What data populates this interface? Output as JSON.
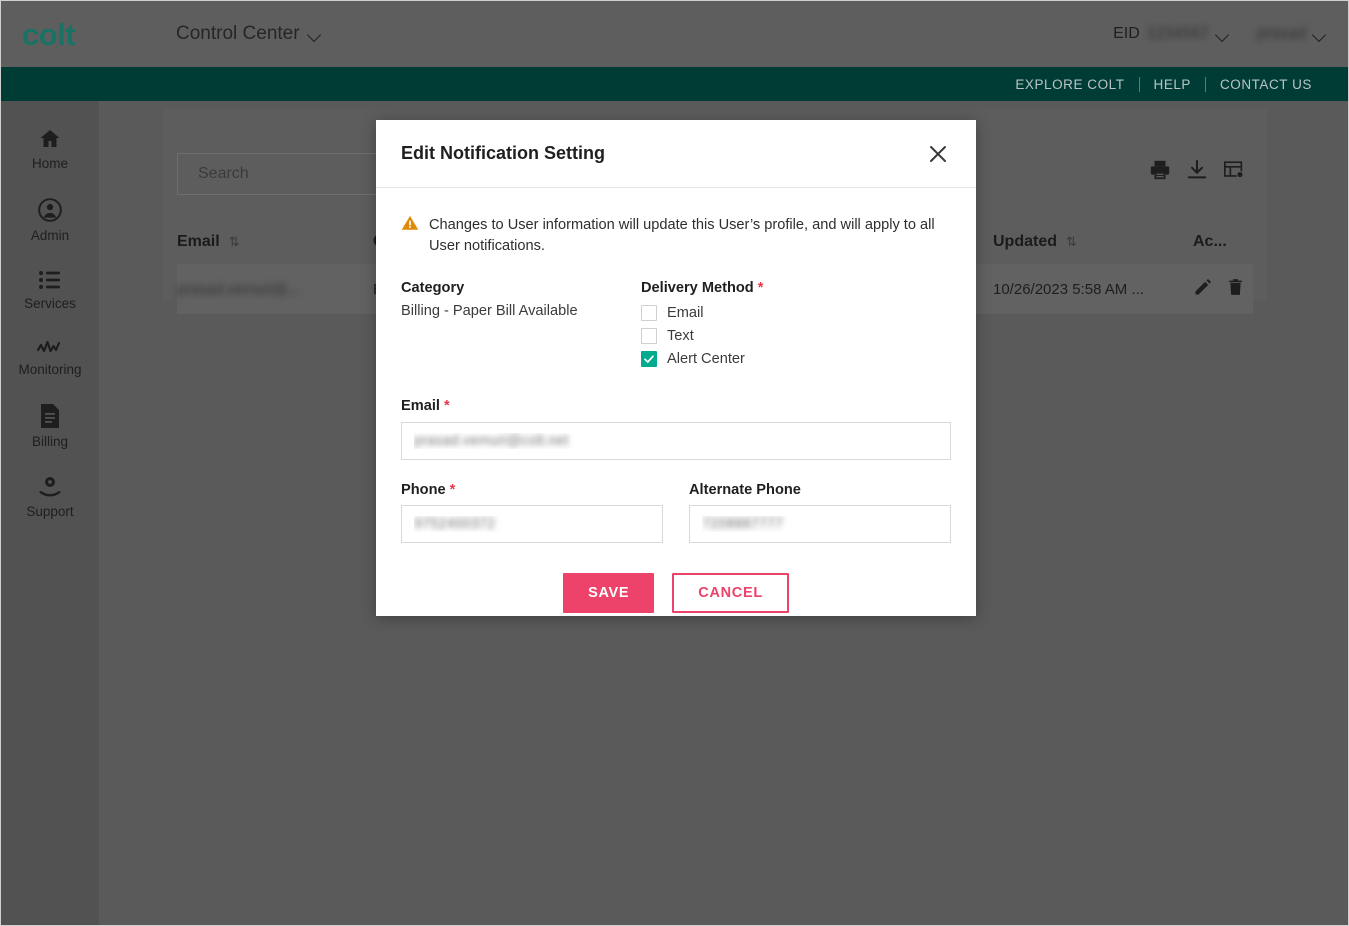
{
  "header": {
    "logo_text": "colt",
    "app_switcher_label": "Control Center",
    "eid_label": "EID",
    "eid_value": "1234567",
    "account_value": "prasad"
  },
  "utility_nav": {
    "items": [
      {
        "label": "EXPLORE COLT"
      },
      {
        "label": "HELP"
      },
      {
        "label": "CONTACT US"
      }
    ]
  },
  "sidebar": {
    "items": [
      {
        "label": "Home",
        "icon": "home-icon"
      },
      {
        "label": "Admin",
        "icon": "user-circle-icon"
      },
      {
        "label": "Services",
        "icon": "list-icon"
      },
      {
        "label": "Monitoring",
        "icon": "activity-icon"
      },
      {
        "label": "Billing",
        "icon": "invoice-icon"
      },
      {
        "label": "Support",
        "icon": "support-gear-hand-icon"
      }
    ]
  },
  "main": {
    "search": {
      "placeholder": "Search",
      "value": ""
    },
    "toolbar_icons": [
      {
        "name": "print-icon"
      },
      {
        "name": "download-icon"
      },
      {
        "name": "table-settings-icon"
      }
    ],
    "table": {
      "columns": [
        {
          "label": "Email",
          "sortable": true
        },
        {
          "label": "Cate...",
          "sortable": false
        },
        {
          "label": "Updated",
          "sortable": true
        },
        {
          "label": "Ac...",
          "sortable": false
        }
      ],
      "sort_glyph": "⇅",
      "rows": [
        {
          "email": "prasad.vemuri@...",
          "category": "Billi...",
          "updated": "10/26/2023 5:58 AM ...",
          "actions": [
            "edit-icon",
            "delete-icon"
          ]
        }
      ]
    }
  },
  "modal": {
    "title": "Edit Notification Setting",
    "close_label": "×",
    "alert": {
      "icon": "warning-triangle-icon",
      "text": "Changes to User information will update this User’s profile, and will apply to all User notifications."
    },
    "category": {
      "label": "Category",
      "value": "Billing - Paper Bill Available"
    },
    "delivery_method": {
      "label": "Delivery Method",
      "required_marker": "*",
      "options": [
        {
          "label": "Email",
          "checked": false
        },
        {
          "label": "Text",
          "checked": false
        },
        {
          "label": "Alert Center",
          "checked": true
        }
      ]
    },
    "email_field": {
      "label": "Email",
      "required_marker": "*",
      "value": "prasad.vemuri@colt.net"
    },
    "phone_field": {
      "label": "Phone",
      "required_marker": "*",
      "value": "9752400372"
    },
    "alternate_phone_field": {
      "label": "Alternate Phone",
      "required_marker": "",
      "value": "7208887777"
    },
    "buttons": {
      "save_label": "SAVE",
      "cancel_label": "CANCEL"
    }
  },
  "colors": {
    "brand_teal": "#003c36",
    "logo_green": "#197263",
    "accent_pink": "#ed4269",
    "checkbox_teal": "#00ab8e",
    "warning_orange": "#e08a0a",
    "required_red": "#e8374a",
    "overlay_gray": "#5a5a5a"
  }
}
